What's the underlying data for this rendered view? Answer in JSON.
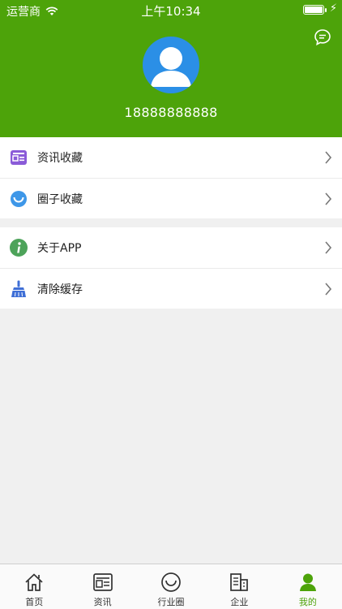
{
  "status_bar": {
    "carrier": "运营商",
    "time": "上午10:34"
  },
  "profile": {
    "phone": "18888888888",
    "avatar_icon": "user-avatar-icon",
    "message_icon": "chat-bubble-icon"
  },
  "menu_group_1": [
    {
      "label": "资讯收藏",
      "icon": "news-icon",
      "color": "#8a5bd8"
    },
    {
      "label": "圈子收藏",
      "icon": "circle-smile-icon",
      "color": "#3e97e8"
    }
  ],
  "menu_group_2": [
    {
      "label": "关于APP",
      "icon": "info-icon",
      "color": "#4da35a"
    },
    {
      "label": "清除缓存",
      "icon": "broom-icon",
      "color": "#3f6fd6"
    }
  ],
  "tabs": [
    {
      "label": "首页",
      "icon": "home-icon"
    },
    {
      "label": "资讯",
      "icon": "news-icon"
    },
    {
      "label": "行业圈",
      "icon": "circle-icon"
    },
    {
      "label": "企业",
      "icon": "building-icon"
    },
    {
      "label": "我的",
      "icon": "user-icon",
      "active": true
    }
  ],
  "colors": {
    "brand": "#4da30a",
    "background": "#f0f0f0"
  }
}
